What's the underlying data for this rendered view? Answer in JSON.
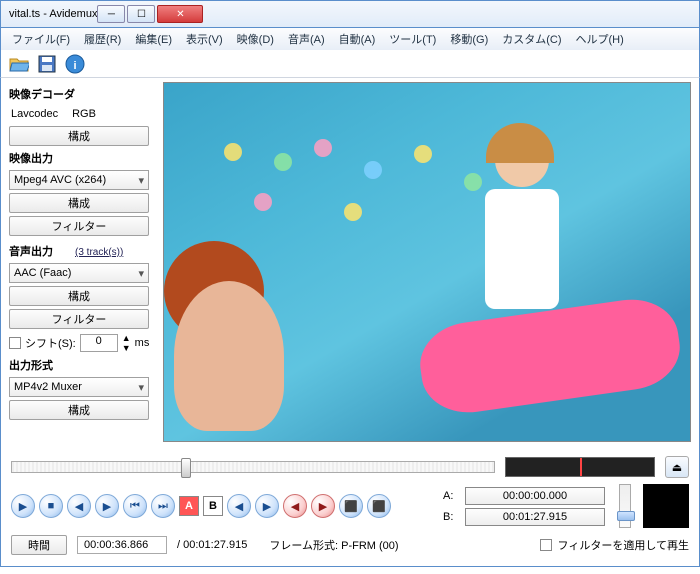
{
  "title": "vital.ts - Avidemux",
  "menu": [
    "ファイル(F)",
    "履歴(R)",
    "編集(E)",
    "表示(V)",
    "映像(D)",
    "音声(A)",
    "自動(A)",
    "ツール(T)",
    "移動(G)",
    "カスタム(C)",
    "ヘルプ(H)"
  ],
  "sidebar": {
    "decoder_title": "映像デコーダ",
    "decoder_codec": "Lavcodec",
    "decoder_color": "RGB",
    "configure": "構成",
    "video_out_title": "映像出力",
    "video_codec": "Mpeg4 AVC (x264)",
    "filter": "フィルター",
    "audio_out_title": "音声出力",
    "tracks": "(3 track(s))",
    "audio_codec": "AAC (Faac)",
    "shift_label": "シフト(S):",
    "shift_value": "0",
    "shift_unit": "ms",
    "format_title": "出力形式",
    "muxer": "MP4v2 Muxer"
  },
  "timeline": {
    "a_label": "A:",
    "a_tc": "00:00:00.000",
    "b_label": "B:",
    "b_tc": "00:01:27.915",
    "apply_filter": "フィルターを適用して再生",
    "time_btn": "時間",
    "cur_tc": "00:00:36.866",
    "total_tc": "/ 00:01:27.915",
    "frame_label": "フレーム形式: P-FRM (00)"
  }
}
